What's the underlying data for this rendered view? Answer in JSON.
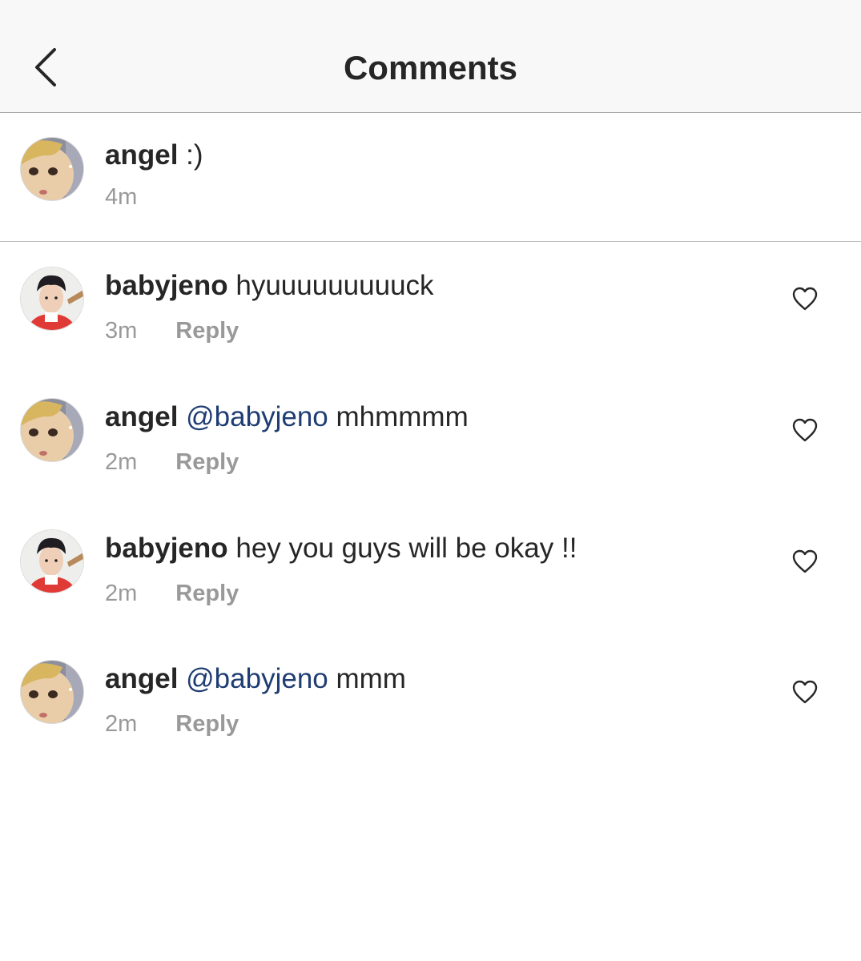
{
  "header": {
    "title": "Comments",
    "back_icon": "chevron-left-icon"
  },
  "caption": {
    "username": "angel",
    "text": ":)",
    "time": "4m"
  },
  "comments": [
    {
      "username": "babyjeno",
      "mention": "",
      "text": "hyuuuuuuuuuck",
      "time": "3m",
      "reply_label": "Reply",
      "avatar": "babyjeno"
    },
    {
      "username": "angel",
      "mention": "@babyjeno",
      "text": "mhmmmm",
      "time": "2m",
      "reply_label": "Reply",
      "avatar": "angel"
    },
    {
      "username": "babyjeno",
      "mention": "",
      "text": "hey you guys will be okay !!",
      "time": "2m",
      "reply_label": "Reply",
      "avatar": "babyjeno"
    },
    {
      "username": "angel",
      "mention": "@babyjeno",
      "text": "mmm",
      "time": "2m",
      "reply_label": "Reply",
      "avatar": "angel"
    }
  ],
  "colors": {
    "header_bg": "#f8f8f8",
    "text": "#262626",
    "muted": "#999999",
    "mention": "#1f3d73"
  }
}
